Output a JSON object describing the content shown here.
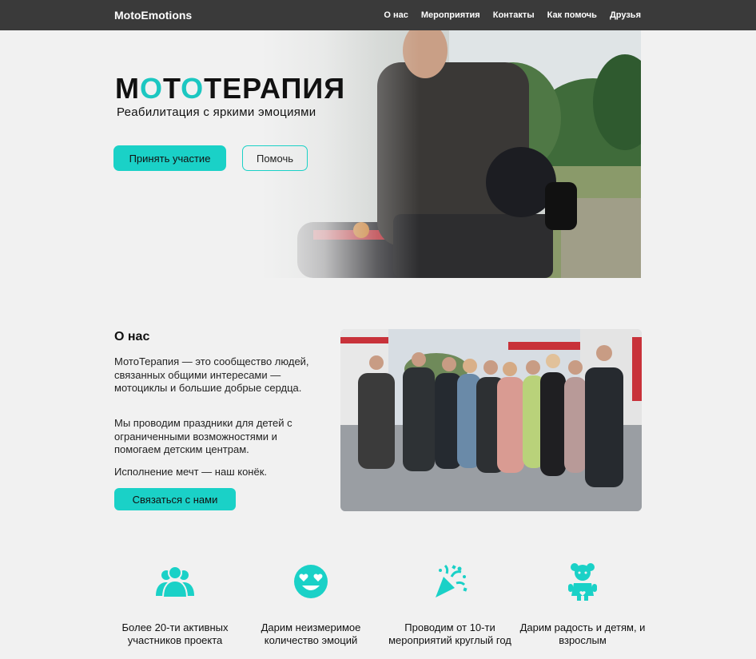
{
  "nav": {
    "brand": "MotoEmotions",
    "links": [
      "О нас",
      "Мероприятия",
      "Контакты",
      "Как помочь",
      "Друзья"
    ]
  },
  "hero": {
    "title_parts": [
      "М",
      "О",
      "Т",
      "О",
      "ТЕРАПИЯ"
    ],
    "subtitle": "Реабилитация с яркими эмоциями",
    "primary_button": "Принять участие",
    "secondary_button": "Помочь"
  },
  "about": {
    "title": "О нас",
    "p1": "МотоТерапия — это сообщество людей, связанных общими интересами — мотоциклы и большие добрые сердца.",
    "p2": "Мы проводим праздники для детей с ограниченными возможностями и помогаем детским центрам.",
    "p3": "Исполнение мечт — наш конёк.",
    "button": "Связаться с нами"
  },
  "features": [
    {
      "icon": "people-icon",
      "text": "Более 20-ти активных участников проекта"
    },
    {
      "icon": "heart-eyes-emoji-icon",
      "text": "Дарим неизмеримое количество эмоций"
    },
    {
      "icon": "party-popper-icon",
      "text": "Проводим от 10-ти мероприятий круглый год"
    },
    {
      "icon": "doll-icon",
      "text": "Дарим радость и детям, и взрослым"
    }
  ],
  "colors": {
    "accent": "#1ad1c7",
    "navbar": "#3a3a3a",
    "background": "#f1f1f1"
  }
}
